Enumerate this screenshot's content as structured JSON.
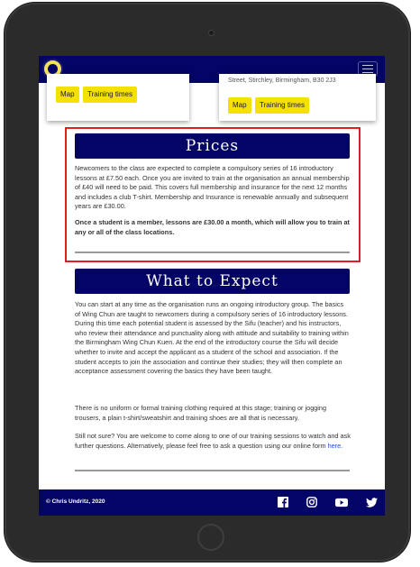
{
  "locations": {
    "left": {
      "map_label": "Map",
      "training_label": "Training times"
    },
    "right": {
      "address_fragment": "Street, Stirchley, Birmingham, B30 2J3",
      "map_label": "Map",
      "training_label": "Training times"
    }
  },
  "prices": {
    "title": "Prices",
    "paragraph1": "Newcomers to the class are expected to complete a compulsory series of 16 introductory lessons at £7.50 each. Once you are invited to train at the organisation an annual membership of £40 will need to be paid. This covers full membership and insurance for the next 12 months and includes a club T-shirt. Membership and Insurance is renewable annually and subsequent years are £30.00.",
    "paragraph2": "Once a student is a member, lessons are £30.00 a month, which will allow you to train at any or all of the class locations."
  },
  "expect": {
    "title": "What to Expect",
    "paragraph1": "You can start at any time as the organisation runs an ongoing introductory group. The basics of Wing Chun are taught to newcomers during a compulsory series of 16 introductory lessons. During this time each potential student is assessed by the Sifu (teacher) and his instructors, who review their attendance and punctuality along with attitude and suitability to training within the Birmingham Wing Chun Kuen. At the end of the introductory course the Sifu will decide whether to invite and accept the applicant as a student of the school and association. If the student accepts to join the association and continue their studies; they will then complete an acceptance assessment covering the basics they have been taught.",
    "paragraph2": "There is no uniform or formal training clothing required at this stage; training or jogging trousers, a plain t-shirt/sweatshirt and training shoes are all that is necessary.",
    "paragraph3_prefix": "Still not sure? You are welcome to come along to one of our training sessions to watch and ask further questions. Alternatively, please feel free to ask a question using our online form ",
    "paragraph3_link": "here",
    "paragraph3_suffix": "."
  },
  "footer": {
    "copyright": "© Chris Undritz, 2020",
    "social_icons": [
      "facebook-icon",
      "instagram-icon",
      "youtube-icon",
      "twitter-icon"
    ]
  },
  "colors": {
    "navy": "#040466",
    "yellow": "#f5e100",
    "highlight": "#e02020"
  }
}
